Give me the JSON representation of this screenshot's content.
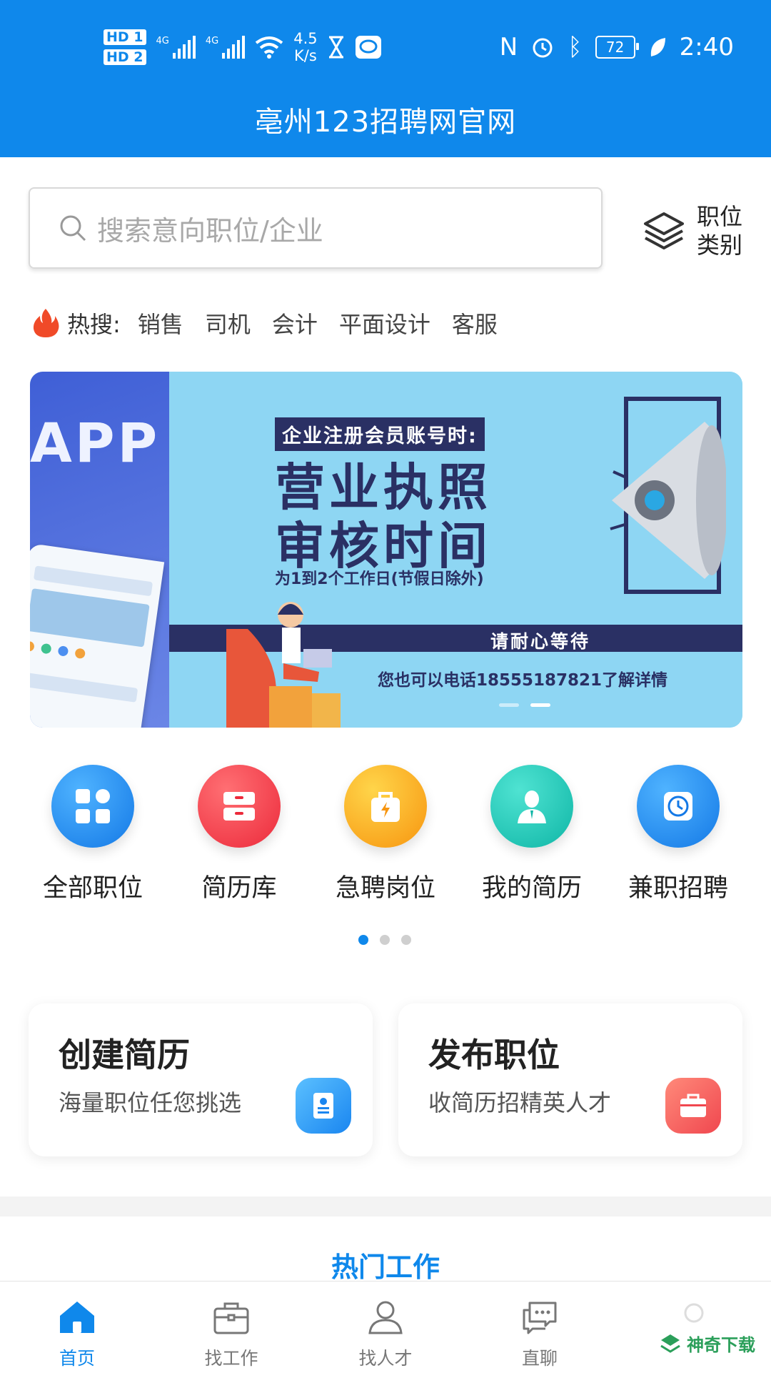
{
  "status_bar": {
    "hd1": "HD 1",
    "hd2": "HD 2",
    "net1": "4G",
    "net2": "4G",
    "speed_value": "4.5",
    "speed_unit": "K/s",
    "battery": "72",
    "time": "2:40"
  },
  "app_title": "亳州123招聘网官网",
  "search": {
    "placeholder": "搜索意向职位/企业",
    "icon": "search-icon"
  },
  "category_button": {
    "label": "职位类别",
    "icon": "layers-icon"
  },
  "hot_search": {
    "label": "热搜:",
    "items": [
      "销售",
      "司机",
      "会计",
      "平面设计",
      "客服"
    ]
  },
  "banner": {
    "left_text": "APP",
    "tag": "企业注册会员账号时:",
    "title_line1": "营业执照",
    "title_line2": "审核时间",
    "subtitle": "为1到2个工作日(节假日除外)",
    "wait_text": "请耐心等待",
    "phone_text": "您也可以电话18555187821了解详情",
    "active_slide": 2,
    "slide_count": 2
  },
  "quick_menu": [
    {
      "label": "全部职位",
      "icon": "grid-icon",
      "color": "#1e8df0"
    },
    {
      "label": "简历库",
      "icon": "drawer-icon",
      "color": "#f5414f"
    },
    {
      "label": "急聘岗位",
      "icon": "lightning-bag-icon",
      "color": "#f9a51a"
    },
    {
      "label": "我的简历",
      "icon": "person-icon",
      "color": "#14c8b9"
    },
    {
      "label": "兼职招聘",
      "icon": "clock-icon",
      "color": "#1e8df0"
    }
  ],
  "menu_pager": {
    "active": 1,
    "count": 3
  },
  "cards": {
    "resume": {
      "title": "创建简历",
      "desc": "海量职位任您挑选",
      "icon": "id-card-icon"
    },
    "post": {
      "title": "发布职位",
      "desc": "收简历招精英人才",
      "icon": "briefcase-icon"
    }
  },
  "section_title": "热门工作",
  "bottom_nav": [
    {
      "label": "首页",
      "icon": "home-icon",
      "active": true
    },
    {
      "label": "找工作",
      "icon": "briefcase-icon",
      "active": false
    },
    {
      "label": "找人才",
      "icon": "user-icon",
      "active": false
    },
    {
      "label": "直聊",
      "icon": "chat-icon",
      "active": false
    }
  ],
  "watermark": "神奇下载",
  "colors": {
    "primary": "#0f88eb",
    "banner_navy": "#2a3064",
    "banner_sky": "#8ed6f3"
  }
}
